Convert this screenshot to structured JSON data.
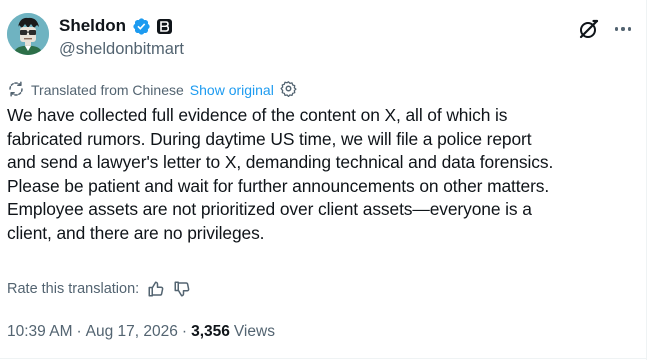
{
  "author": {
    "display_name": "Sheldon",
    "handle": "@sheldonbitmart",
    "verified": true,
    "icons": [
      "verified-badge-icon",
      "affiliate-badge-icon",
      "grok-icon",
      "more-options-icon"
    ]
  },
  "translation": {
    "label": "Translated from Chinese",
    "show_original": "Show original"
  },
  "tweet": {
    "text": "We have collected full evidence of the content on X, all of which is\nfabricated rumors. During daytime US time, we will file a police report\nand send a lawyer's letter to X, demanding technical and data forensics.\nPlease be patient and wait for further announcements on other matters.\nEmployee assets are not prioritized over client assets—everyone is a\nclient, and there are no privileges."
  },
  "rating": {
    "label": "Rate this translation:"
  },
  "meta": {
    "time": "10:39 AM",
    "separator": "·",
    "date": "Aug 17, 2026",
    "views_count": "3,356",
    "views_label": "Views"
  },
  "colors": {
    "text": "#0f1419",
    "secondary": "#536471",
    "link": "#1d9bf0",
    "verified": "#1d9bf0"
  }
}
